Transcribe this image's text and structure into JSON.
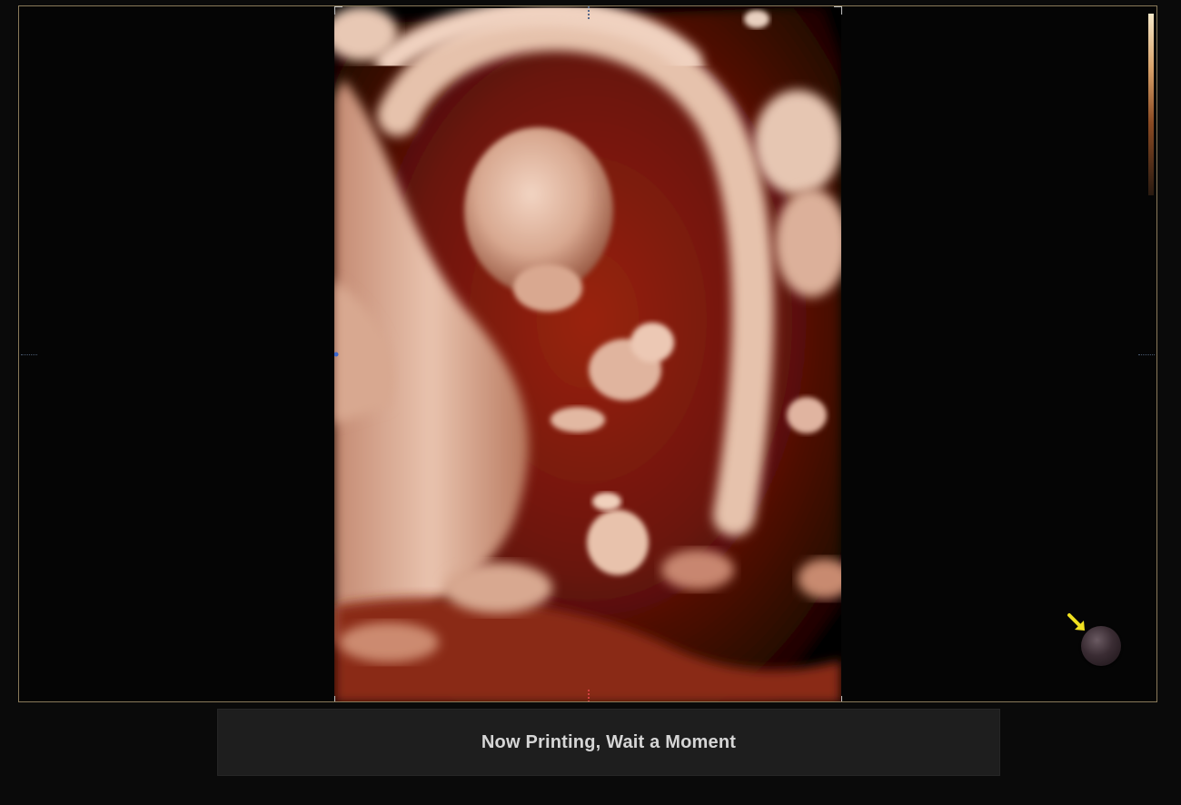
{
  "status": {
    "message": "Now Printing, Wait a Moment"
  },
  "icons": {
    "trackball": "trackball-cursor-icon",
    "pointer": "yellow-arrow-icon",
    "colorbar": "color-scale-bar"
  },
  "colors": {
    "background": "#0a0a0a",
    "viewport_border": "#8a7a5a",
    "status_bar_bg": "#1e1e1e",
    "status_text": "#d6d6d6",
    "tissue_dark": "#7a1a0a",
    "tissue_light": "#e8c0a8",
    "pointer_arrow": "#f0e020"
  }
}
